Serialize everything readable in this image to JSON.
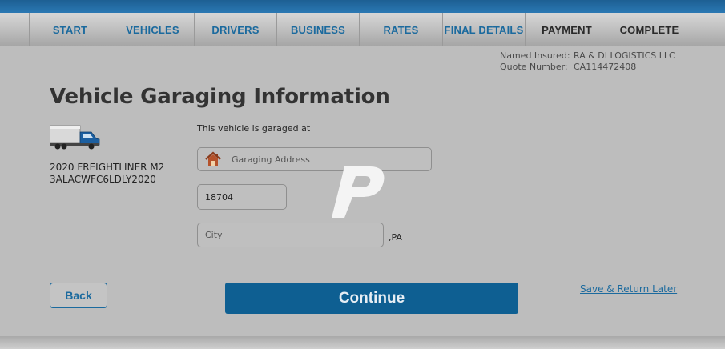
{
  "nav": {
    "tabs": [
      {
        "label": "START",
        "state": "done"
      },
      {
        "label": "VEHICLES",
        "state": "done"
      },
      {
        "label": "DRIVERS",
        "state": "done"
      },
      {
        "label": "BUSINESS",
        "state": "done"
      },
      {
        "label": "RATES",
        "state": "done"
      },
      {
        "label": "FINAL DETAILS",
        "state": "done"
      },
      {
        "label": "PAYMENT",
        "state": "todo"
      },
      {
        "label": "COMPLETE",
        "state": "todo"
      }
    ]
  },
  "insured": {
    "named_label": "Named Insured:",
    "named_value": "RA & DI LOGISTICS LLC",
    "quote_label": "Quote Number:",
    "quote_value": "CA114472408"
  },
  "page": {
    "title": "Vehicle Garaging Information"
  },
  "vehicle": {
    "name": "2020 FREIGHTLINER M2",
    "vin": "3ALACWFC6LDLY2020"
  },
  "form": {
    "garaged_label": "This vehicle is garaged at",
    "address_placeholder": "Garaging Address",
    "zip_value": "18704",
    "city_placeholder": "City",
    "state_suffix": ",PA"
  },
  "actions": {
    "back": "Back",
    "continue": "Continue",
    "save_later": "Save & Return Later"
  },
  "colors": {
    "accent": "#0e5f92",
    "link": "#1b6a9e",
    "background": "#bdbdbd"
  },
  "icons": {
    "home": "home-icon",
    "truck": "box-truck-icon",
    "logo": "progressive-p-logo"
  }
}
